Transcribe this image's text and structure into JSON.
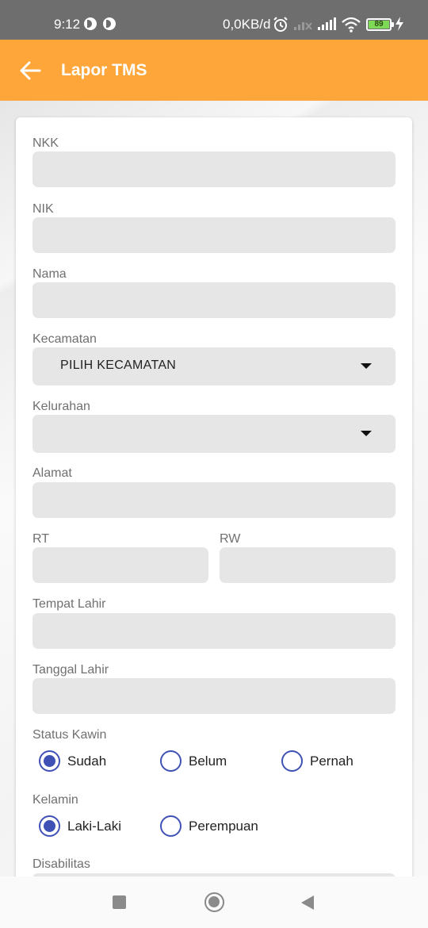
{
  "status_bar": {
    "time": "9:12",
    "network_speed": "0,0KB/d",
    "battery_level": "89",
    "icons": [
      "notification-badge-icon",
      "notification-badge-icon",
      "alarm-icon",
      "signal-off-icon",
      "signal-icon",
      "wifi-icon",
      "battery-icon",
      "charging-icon"
    ]
  },
  "app_bar": {
    "back_icon": "arrow-left-icon",
    "title": "Lapor TMS",
    "color": "#ffa63a"
  },
  "form": {
    "nkk": {
      "label": "NKK",
      "value": ""
    },
    "nik": {
      "label": "NIK",
      "value": ""
    },
    "nama": {
      "label": "Nama",
      "value": ""
    },
    "kecamatan": {
      "label": "Kecamatan",
      "selected": "PILIH KECAMATAN"
    },
    "kelurahan": {
      "label": "Kelurahan",
      "selected": ""
    },
    "alamat": {
      "label": "Alamat",
      "value": ""
    },
    "rt": {
      "label": "RT",
      "value": ""
    },
    "rw": {
      "label": "RW",
      "value": ""
    },
    "tempat_lahir": {
      "label": "Tempat Lahir",
      "value": ""
    },
    "tanggal_lahir": {
      "label": "Tanggal Lahir",
      "value": ""
    },
    "status_kawin": {
      "label": "Status Kawin",
      "options": [
        {
          "label": "Sudah",
          "checked": true
        },
        {
          "label": "Belum",
          "checked": false
        },
        {
          "label": "Pernah",
          "checked": false
        }
      ]
    },
    "kelamin": {
      "label": "Kelamin",
      "options": [
        {
          "label": "Laki-Laki",
          "checked": true
        },
        {
          "label": "Perempuan",
          "checked": false
        }
      ]
    },
    "disabilitas": {
      "label": "Disabilitas"
    }
  },
  "accent_color": "#3f51b5",
  "nav_bar": {
    "icons": [
      "recents-square-icon",
      "home-circle-icon",
      "back-triangle-icon"
    ]
  }
}
